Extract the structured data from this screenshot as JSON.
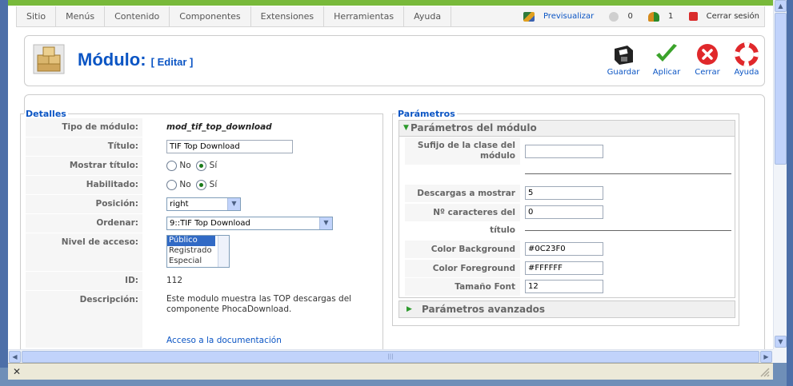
{
  "menu": {
    "items": [
      "Sitio",
      "Menús",
      "Contenido",
      "Componentes",
      "Extensiones",
      "Herramientas",
      "Ayuda"
    ],
    "preview": "Previsualizar",
    "messages_count": "0",
    "users_count": "1",
    "logout": "Cerrar sesión"
  },
  "toolbar": {
    "title": "Módulo:",
    "subtitle": "[ Editar ]",
    "buttons": {
      "save": "Guardar",
      "apply": "Aplicar",
      "close": "Cerrar",
      "help": "Ayuda"
    },
    "colors": {
      "accent": "#0b55c4",
      "close": "#e0282b",
      "apply": "#3ba32b"
    }
  },
  "details": {
    "legend": "Detalles",
    "module_type_label": "Tipo de módulo:",
    "module_type": "mod_tif_top_download",
    "title_label": "Título:",
    "title_value": "TIF Top Download",
    "show_title_label": "Mostrar título:",
    "enabled_label": "Habilitado:",
    "no": "No",
    "yes": "Sí",
    "position_label": "Posición:",
    "position_value": "right",
    "order_label": "Ordenar:",
    "order_value": "9::TIF Top Download",
    "access_label": "Nivel de acceso:",
    "access_options": [
      "Público",
      "Registrado",
      "Especial"
    ],
    "id_label": "ID:",
    "id_value": "112",
    "description_label": "Descripción:",
    "description": "Este modulo muestra las TOP descargas del componente PhocaDownload.",
    "docs_link": "Acceso a la documentación"
  },
  "params": {
    "legend": "Parámetros",
    "module_params": "Parámetros del módulo",
    "suffix_label": "Sufijo de la clase del módulo",
    "suffix_value": "",
    "downloads_label": "Descargas a mostrar",
    "downloads_value": "5",
    "title_chars_label": "Nº caracteres del título",
    "title_chars_value": "0",
    "bg_label": "Color Background",
    "bg_value": "#0C23F0",
    "fg_label": "Color Foreground",
    "fg_value": "#FFFFFF",
    "font_label": "Tamaño Font",
    "font_value": "12",
    "advanced": "Parámetros avanzados"
  }
}
